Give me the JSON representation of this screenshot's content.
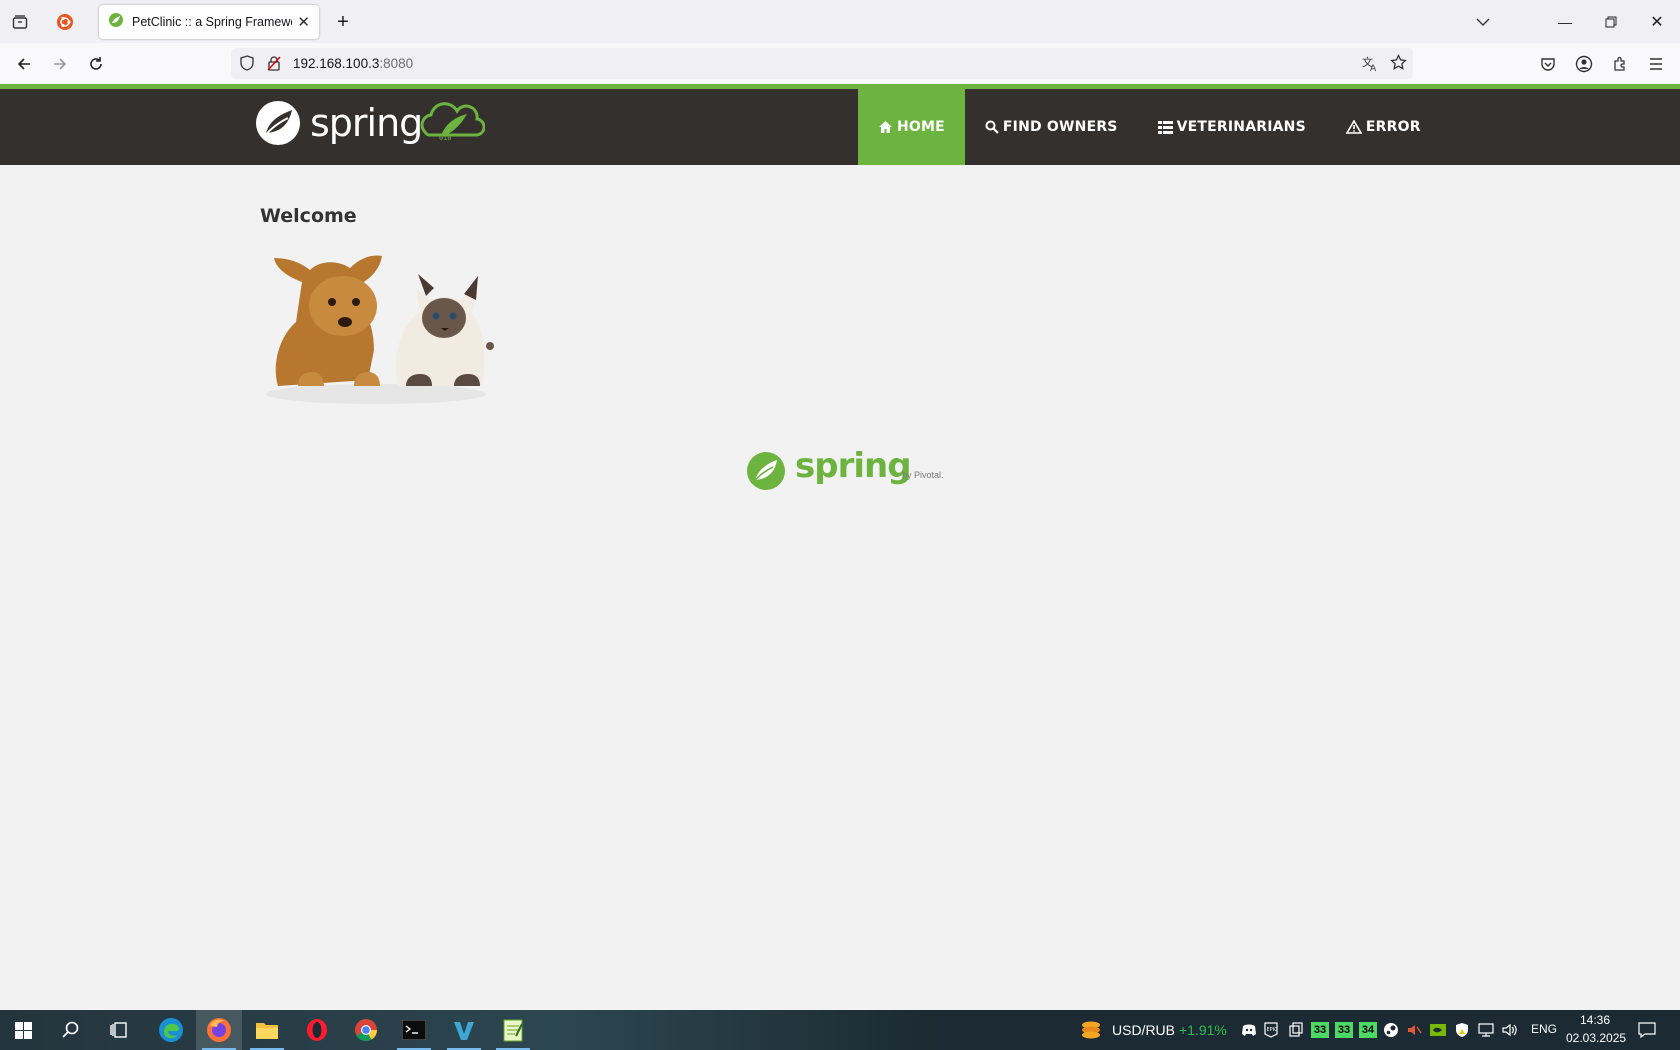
{
  "browser": {
    "tab_title": "PetClinic :: a Spring Framework",
    "url_host": "192.168.100.3",
    "url_port": ":8080"
  },
  "app": {
    "logo_text": "spring",
    "menu": [
      {
        "label": "HOME",
        "icon": "home-icon",
        "active": true
      },
      {
        "label": "FIND OWNERS",
        "icon": "search-icon",
        "active": false
      },
      {
        "label": "VETERINARIANS",
        "icon": "list-icon",
        "active": false
      },
      {
        "label": "ERROR",
        "icon": "warning-icon",
        "active": false
      }
    ],
    "welcome": "Welcome",
    "footer_logo": "spring",
    "footer_by": "by Pivotal."
  },
  "taskbar": {
    "ticker_label": "USD/RUB",
    "ticker_change": "+1.91%",
    "tray_numbers": [
      "33",
      "33",
      "34"
    ],
    "language": "ENG",
    "time": "14:36",
    "date": "02.03.2025"
  },
  "colors": {
    "spring_green": "#6db33f",
    "header_dark": "#34302d",
    "page_bg": "#f2f2f2"
  }
}
